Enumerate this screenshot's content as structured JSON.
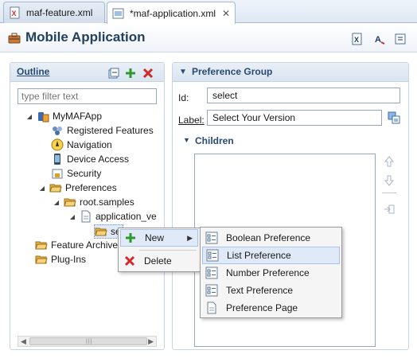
{
  "tabs": [
    {
      "label": "maf-feature.xml"
    },
    {
      "label": "*maf-application.xml",
      "close": "✕"
    }
  ],
  "header": {
    "title": "Mobile Application"
  },
  "outline": {
    "title": "Outline",
    "filter_placeholder": "type filter text",
    "tree": [
      {
        "label": "MyMAFApp"
      },
      {
        "label": "Registered Features"
      },
      {
        "label": "Navigation"
      },
      {
        "label": "Device Access"
      },
      {
        "label": "Security"
      },
      {
        "label": "Preferences"
      },
      {
        "label": "root.samples"
      },
      {
        "label": "application_ve"
      },
      {
        "label": "se"
      },
      {
        "label": "Feature Archive"
      },
      {
        "label": "Plug-Ins"
      }
    ]
  },
  "pref": {
    "title": "Preference Group",
    "id_label": "Id:",
    "id_value": "select",
    "label_label": "Label:",
    "label_value": "Select Your Version",
    "children_title": "Children"
  },
  "context_menu": {
    "new_label": "New",
    "delete_label": "Delete"
  },
  "submenu": {
    "items": [
      {
        "label": "Boolean Preference"
      },
      {
        "label": "List Preference"
      },
      {
        "label": "Number Preference"
      },
      {
        "label": "Text Preference"
      },
      {
        "label": "Preference Page"
      }
    ]
  }
}
